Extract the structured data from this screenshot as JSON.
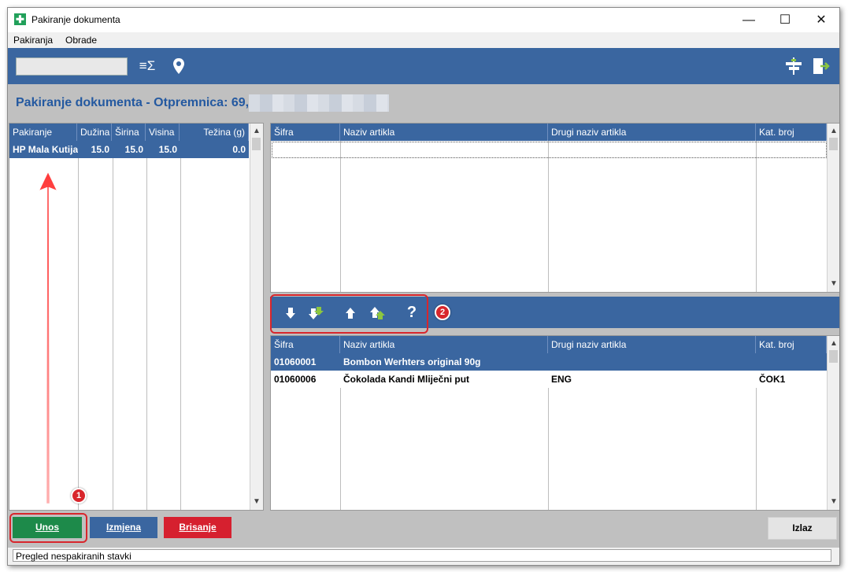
{
  "window": {
    "title": "Pakiranje dokumenta",
    "app_icon_glyph": "✚",
    "minimize_glyph": "—",
    "maximize_glyph": "☐",
    "close_glyph": "✕"
  },
  "menu": [
    "Pakiranja",
    "Obrade"
  ],
  "toolbar": {
    "search_value": "",
    "sum_icon_glyph": "≡Σ",
    "location_icon_glyph": "⚲",
    "sign_icon_glyph": "⚍",
    "exit_icon_glyph": "⇨"
  },
  "heading": "Pakiranje dokumenta - Otpremnica: 69,",
  "packages": {
    "columns": [
      "Pakiranje",
      "Dužina",
      "Širina",
      "Visina",
      "Težina (g)"
    ],
    "rows": [
      {
        "pakiranje": "HP Mala Kutija",
        "duzina": "15.0",
        "sirina": "15.0",
        "visina": "15.0",
        "tezina": "0.0"
      }
    ]
  },
  "top_grid": {
    "columns": [
      "Šifra",
      "Naziv artikla",
      "Drugi naziv artikla",
      "Kat. broj"
    ]
  },
  "mid_toolbar": {
    "icons": [
      "🡇",
      "🡇",
      "🡅",
      "🡅",
      "?"
    ]
  },
  "bottom_grid": {
    "columns": [
      "Šifra",
      "Naziv artikla",
      "Drugi naziv artikla",
      "Kat. broj"
    ],
    "rows": [
      {
        "sifra": "01060001",
        "naziv": "Bombon Werhters original 90g",
        "drugi": "",
        "kat": ""
      },
      {
        "sifra": "01060006",
        "naziv": "Čokolada Kandi Mliječni put",
        "drugi": "ENG",
        "kat": "ČOK1"
      }
    ]
  },
  "annotations": {
    "badge1": "1",
    "badge2": "2"
  },
  "buttons": {
    "unos": "Unos",
    "izmjena": "Izmjena",
    "brisanje": "Brisanje",
    "izlaz": "Izlaz"
  },
  "status": "Pregled nespakiranih stavki",
  "scroll": {
    "up": "▲",
    "down": "▼"
  },
  "colors": {
    "header_blue": "#3a66a0",
    "selection_blue": "#3a66a0",
    "unos_green": "#1d8a4a",
    "izmjena_blue": "#3a66a0",
    "brisanje_red": "#d6202f",
    "highlight_red": "#d8262c",
    "heading_blue": "#2459a0"
  }
}
